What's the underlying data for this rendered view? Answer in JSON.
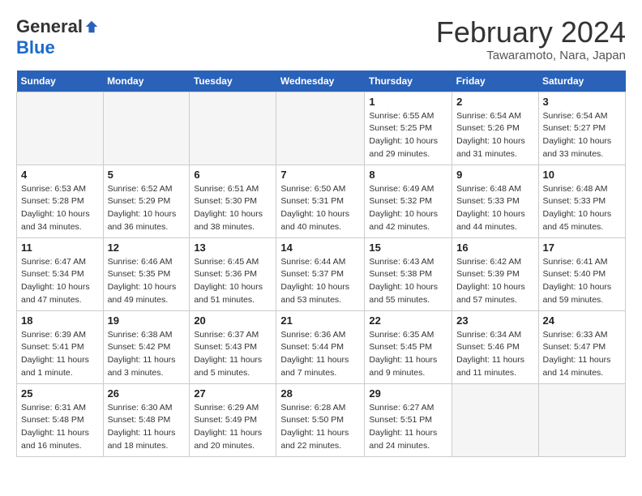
{
  "header": {
    "logo_general": "General",
    "logo_blue": "Blue",
    "month_title": "February 2024",
    "location": "Tawaramoto, Nara, Japan"
  },
  "weekdays": [
    "Sunday",
    "Monday",
    "Tuesday",
    "Wednesday",
    "Thursday",
    "Friday",
    "Saturday"
  ],
  "weeks": [
    [
      {
        "day": "",
        "empty": true
      },
      {
        "day": "",
        "empty": true
      },
      {
        "day": "",
        "empty": true
      },
      {
        "day": "",
        "empty": true
      },
      {
        "day": "1",
        "sunrise": "6:55 AM",
        "sunset": "5:25 PM",
        "daylight": "10 hours and 29 minutes."
      },
      {
        "day": "2",
        "sunrise": "6:54 AM",
        "sunset": "5:26 PM",
        "daylight": "10 hours and 31 minutes."
      },
      {
        "day": "3",
        "sunrise": "6:54 AM",
        "sunset": "5:27 PM",
        "daylight": "10 hours and 33 minutes."
      }
    ],
    [
      {
        "day": "4",
        "sunrise": "6:53 AM",
        "sunset": "5:28 PM",
        "daylight": "10 hours and 34 minutes."
      },
      {
        "day": "5",
        "sunrise": "6:52 AM",
        "sunset": "5:29 PM",
        "daylight": "10 hours and 36 minutes."
      },
      {
        "day": "6",
        "sunrise": "6:51 AM",
        "sunset": "5:30 PM",
        "daylight": "10 hours and 38 minutes."
      },
      {
        "day": "7",
        "sunrise": "6:50 AM",
        "sunset": "5:31 PM",
        "daylight": "10 hours and 40 minutes."
      },
      {
        "day": "8",
        "sunrise": "6:49 AM",
        "sunset": "5:32 PM",
        "daylight": "10 hours and 42 minutes."
      },
      {
        "day": "9",
        "sunrise": "6:48 AM",
        "sunset": "5:33 PM",
        "daylight": "10 hours and 44 minutes."
      },
      {
        "day": "10",
        "sunrise": "6:48 AM",
        "sunset": "5:33 PM",
        "daylight": "10 hours and 45 minutes."
      }
    ],
    [
      {
        "day": "11",
        "sunrise": "6:47 AM",
        "sunset": "5:34 PM",
        "daylight": "10 hours and 47 minutes."
      },
      {
        "day": "12",
        "sunrise": "6:46 AM",
        "sunset": "5:35 PM",
        "daylight": "10 hours and 49 minutes."
      },
      {
        "day": "13",
        "sunrise": "6:45 AM",
        "sunset": "5:36 PM",
        "daylight": "10 hours and 51 minutes."
      },
      {
        "day": "14",
        "sunrise": "6:44 AM",
        "sunset": "5:37 PM",
        "daylight": "10 hours and 53 minutes."
      },
      {
        "day": "15",
        "sunrise": "6:43 AM",
        "sunset": "5:38 PM",
        "daylight": "10 hours and 55 minutes."
      },
      {
        "day": "16",
        "sunrise": "6:42 AM",
        "sunset": "5:39 PM",
        "daylight": "10 hours and 57 minutes."
      },
      {
        "day": "17",
        "sunrise": "6:41 AM",
        "sunset": "5:40 PM",
        "daylight": "10 hours and 59 minutes."
      }
    ],
    [
      {
        "day": "18",
        "sunrise": "6:39 AM",
        "sunset": "5:41 PM",
        "daylight": "11 hours and 1 minute."
      },
      {
        "day": "19",
        "sunrise": "6:38 AM",
        "sunset": "5:42 PM",
        "daylight": "11 hours and 3 minutes."
      },
      {
        "day": "20",
        "sunrise": "6:37 AM",
        "sunset": "5:43 PM",
        "daylight": "11 hours and 5 minutes."
      },
      {
        "day": "21",
        "sunrise": "6:36 AM",
        "sunset": "5:44 PM",
        "daylight": "11 hours and 7 minutes."
      },
      {
        "day": "22",
        "sunrise": "6:35 AM",
        "sunset": "5:45 PM",
        "daylight": "11 hours and 9 minutes."
      },
      {
        "day": "23",
        "sunrise": "6:34 AM",
        "sunset": "5:46 PM",
        "daylight": "11 hours and 11 minutes."
      },
      {
        "day": "24",
        "sunrise": "6:33 AM",
        "sunset": "5:47 PM",
        "daylight": "11 hours and 14 minutes."
      }
    ],
    [
      {
        "day": "25",
        "sunrise": "6:31 AM",
        "sunset": "5:48 PM",
        "daylight": "11 hours and 16 minutes."
      },
      {
        "day": "26",
        "sunrise": "6:30 AM",
        "sunset": "5:48 PM",
        "daylight": "11 hours and 18 minutes."
      },
      {
        "day": "27",
        "sunrise": "6:29 AM",
        "sunset": "5:49 PM",
        "daylight": "11 hours and 20 minutes."
      },
      {
        "day": "28",
        "sunrise": "6:28 AM",
        "sunset": "5:50 PM",
        "daylight": "11 hours and 22 minutes."
      },
      {
        "day": "29",
        "sunrise": "6:27 AM",
        "sunset": "5:51 PM",
        "daylight": "11 hours and 24 minutes."
      },
      {
        "day": "",
        "empty": true
      },
      {
        "day": "",
        "empty": true
      }
    ]
  ],
  "labels": {
    "sunrise": "Sunrise:",
    "sunset": "Sunset:",
    "daylight": "Daylight:"
  }
}
